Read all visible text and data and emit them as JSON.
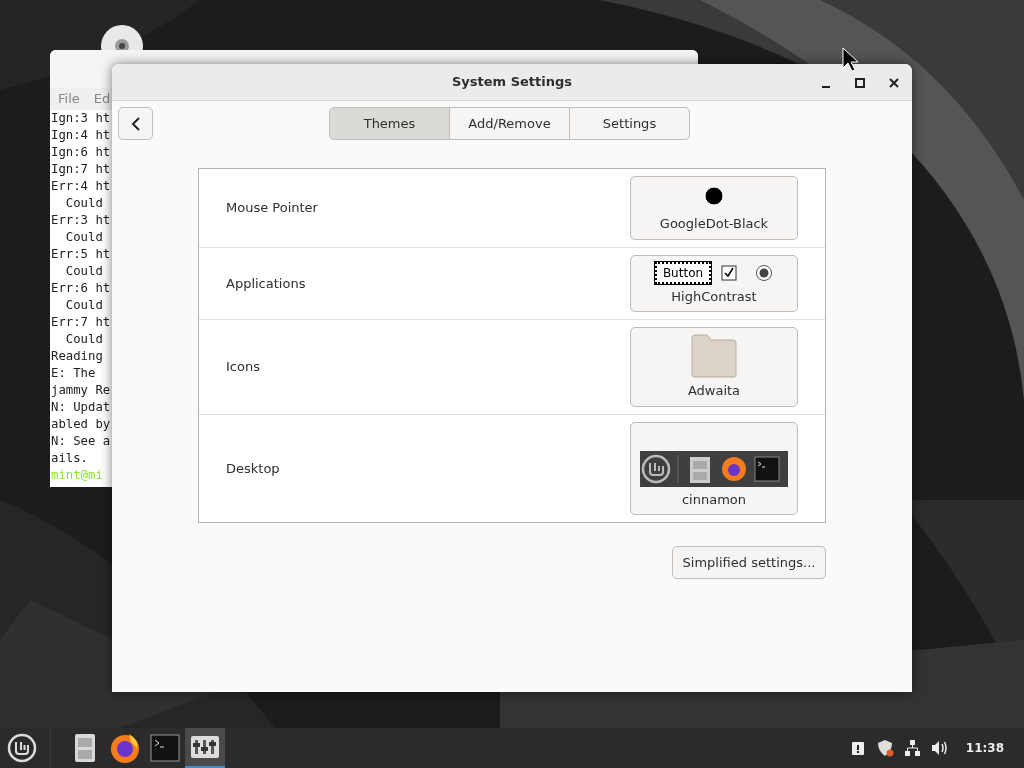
{
  "terminal": {
    "menu": [
      "File",
      "Ed"
    ],
    "lines": [
      {
        "text": "Ign:3 ht",
        "kind": "output"
      },
      {
        "text": "Ign:4 ht",
        "kind": "output"
      },
      {
        "text": "Ign:6 ht",
        "kind": "output"
      },
      {
        "text": "Ign:7 ht",
        "kind": "output"
      },
      {
        "text": "Err:4 ht",
        "kind": "output"
      },
      {
        "text": "  Could",
        "kind": "output"
      },
      {
        "text": "Err:3 ht",
        "kind": "output"
      },
      {
        "text": "  Could",
        "kind": "output"
      },
      {
        "text": "Err:5 ht",
        "kind": "output"
      },
      {
        "text": "  Could",
        "kind": "output"
      },
      {
        "text": "Err:6 ht",
        "kind": "output"
      },
      {
        "text": "  Could",
        "kind": "output"
      },
      {
        "text": "Err:7 ht",
        "kind": "output"
      },
      {
        "text": "  Could",
        "kind": "output"
      },
      {
        "text": "Reading",
        "kind": "output"
      },
      {
        "text": "E: The",
        "kind": "output"
      },
      {
        "text": "jammy Re",
        "kind": "output"
      },
      {
        "text": "N: Updat",
        "kind": "output"
      },
      {
        "text": "abled by",
        "kind": "output"
      },
      {
        "text": "N: See a",
        "kind": "output"
      },
      {
        "text": "ails.",
        "kind": "output"
      },
      {
        "text": "mint@mi",
        "kind": "prompt"
      }
    ]
  },
  "settings_window": {
    "title": "System Settings",
    "tabs": [
      {
        "label": "Themes",
        "selected": true
      },
      {
        "label": "Add/Remove",
        "selected": false
      },
      {
        "label": "Settings",
        "selected": false
      }
    ],
    "rows": [
      {
        "label": "Mouse Pointer",
        "kind": "pointer",
        "theme": "GoogleDot-Black"
      },
      {
        "label": "Applications",
        "kind": "applications",
        "theme": "HighContrast",
        "sample_button": "Button",
        "checked": true,
        "radio_selected": true
      },
      {
        "label": "Icons",
        "kind": "icons",
        "theme": "Adwaita"
      },
      {
        "label": "Desktop",
        "kind": "desktop",
        "theme": "cinnamon"
      }
    ],
    "simplified_button": "Simplified settings..."
  },
  "taskbar": {
    "apps": [
      {
        "kind": "files",
        "active": false
      },
      {
        "kind": "browser",
        "active": false
      },
      {
        "kind": "terminal",
        "active": false
      },
      {
        "kind": "settings",
        "active": true
      }
    ],
    "clock": "11:38"
  }
}
